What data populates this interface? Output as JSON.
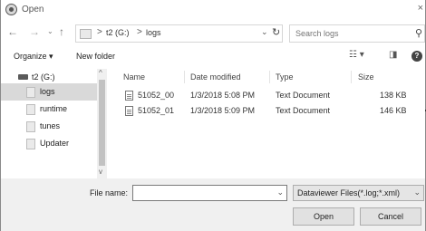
{
  "window": {
    "title": "Open",
    "close_glyph": "×"
  },
  "navigation": {
    "back_icon": "arrow-left-icon",
    "forward_icon": "arrow-right-icon",
    "recent_icon": "chevron-down-icon",
    "up_icon": "arrow-up-icon"
  },
  "address": {
    "separator": ">",
    "crumbs": [
      "t2 (G:)",
      "logs"
    ],
    "dropdown_glyph": "⌄",
    "refresh_glyph": "↻"
  },
  "search": {
    "placeholder": "Search logs",
    "icon_glyph": "⚲"
  },
  "toolbar": {
    "organize_label": "Organize ▾",
    "new_folder_label": "New folder",
    "help_label": "?"
  },
  "nav_tree": {
    "items": [
      {
        "label": "t2 (G:)",
        "type": "drive",
        "selected": false
      },
      {
        "label": "logs",
        "type": "folder",
        "selected": true
      },
      {
        "label": "runtime",
        "type": "folder",
        "selected": false
      },
      {
        "label": "tunes",
        "type": "folder",
        "selected": false
      },
      {
        "label": "Updater",
        "type": "folder",
        "selected": false
      }
    ]
  },
  "file_list": {
    "columns": [
      "Name",
      "Date modified",
      "Type",
      "Size"
    ],
    "rows": [
      {
        "name": "51052_00",
        "modified": "1/3/2018 5:08 PM",
        "type": "Text Document",
        "size": "138 KB"
      },
      {
        "name": "51052_01",
        "modified": "1/3/2018 5:09 PM",
        "type": "Text Document",
        "size": "146 KB"
      }
    ]
  },
  "footer": {
    "file_name_label": "File name:",
    "file_name_value": "",
    "filter_label": "Dataviewer Files(*.log;*.xml)",
    "open_label": "Open",
    "cancel_label": "Cancel"
  },
  "colors": {
    "selection": "#d9d9d9",
    "footer_bg": "#f0f0f0"
  }
}
